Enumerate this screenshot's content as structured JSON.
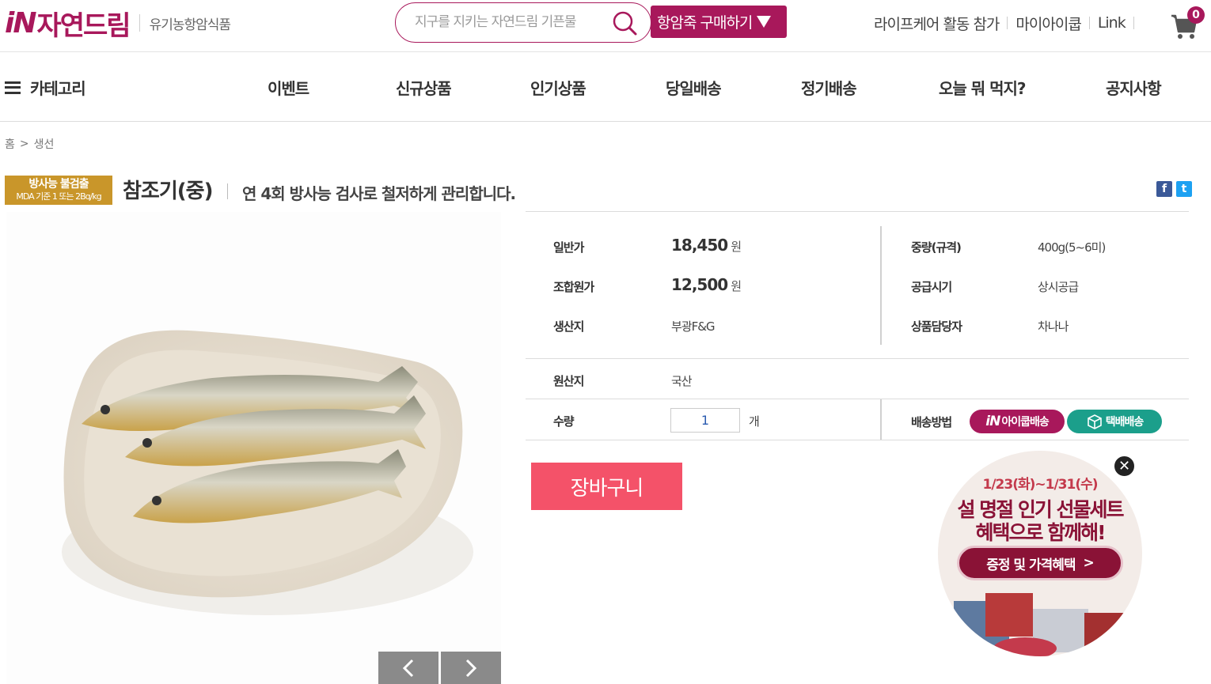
{
  "header": {
    "logo_mark": "iN",
    "logo_text": "자연드림",
    "logo_sub": "유기농항암식품",
    "search_placeholder": "지구를 지키는 자연드림 기픈물",
    "buy_button": "항암죽 구매하기",
    "top_links": [
      "라이프케어 활동 참가",
      "마이아이쿱",
      "Link"
    ],
    "cart_count": "0"
  },
  "nav": {
    "category": "카테고리",
    "items": [
      "이벤트",
      "신규상품",
      "인기상품",
      "당일배송",
      "정기배송",
      "오늘 뭐 먹지?",
      "공지사항"
    ]
  },
  "breadcrumb": [
    "홈",
    ">",
    "생선"
  ],
  "product": {
    "badge_line1": "방사능 불검출",
    "badge_line2": "MDA 기준 1 또는 2Bq/kg",
    "title": "참조기(중)",
    "slogan": "연 4회 방사능 검사로 철저하게 관리합니다.",
    "share": {
      "facebook": "f",
      "twitter": "t"
    }
  },
  "info": {
    "regular_price_label": "일반가",
    "regular_price": "18,450",
    "member_price_label": "조합원가",
    "member_price": "12,500",
    "currency": "원",
    "producer_label": "생산지",
    "producer": "부광F&G",
    "weight_label": "중량(규격)",
    "weight": "400g(5~6미)",
    "supply_label": "공급시기",
    "supply": "상시공급",
    "manager_label": "상품담당자",
    "manager": "차나나",
    "origin_label": "원산지",
    "origin": "국산",
    "qty_label": "수량",
    "qty_value": "1",
    "qty_unit": "개",
    "shipping_label": "배송방법",
    "ship_icoop_mark": "iN",
    "ship_icoop": "아이쿱배송",
    "ship_parcel": "택배배송"
  },
  "cart_button": "장바구니",
  "promo": {
    "date": "1/23(화)~1/31(수)",
    "title_line1": "설 명절 인기 선물세트",
    "title_line2": "혜택으로 함께해!",
    "button": "증정 및 가격혜택",
    "button_arrow": ">"
  },
  "colors": {
    "brand": "#a8185b",
    "cart_button": "#f45269",
    "parcel": "#1b9f8b",
    "badge_gold": "#c9962a"
  }
}
